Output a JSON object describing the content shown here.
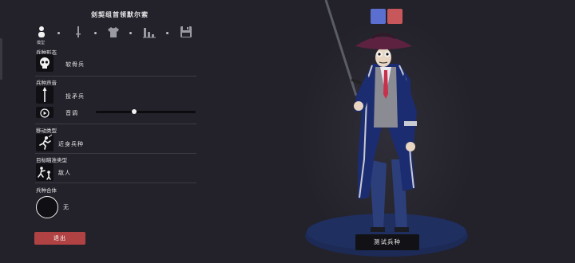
{
  "window": {
    "title": "剑契组首领默尔索"
  },
  "steps": {
    "items": [
      {
        "icon": "person-icon",
        "active": true
      },
      {
        "icon": "sword-icon",
        "active": false
      },
      {
        "icon": "shirt-icon",
        "active": false
      },
      {
        "icon": "stats-icon",
        "active": false
      },
      {
        "icon": "save-icon",
        "active": false
      }
    ],
    "active_label": "模型"
  },
  "sections": {
    "form": {
      "label": "兵种形态",
      "value": "软骨兵"
    },
    "voice": {
      "label": "兵种声音",
      "value": "投矛兵",
      "pitch_label": "音调",
      "pitch_level": 0.38
    },
    "movement": {
      "label": "移动类型",
      "value": "近身兵种"
    },
    "target": {
      "label": "目标瞄准类型",
      "value": "敌人"
    },
    "combine": {
      "label": "兵种合体",
      "value": "无"
    }
  },
  "buttons": {
    "exit": "退出",
    "test": "测试兵种"
  },
  "colors": {
    "team_blue": "#5a6fd0",
    "team_red": "#c8575c",
    "exit_red": "#b04243",
    "background": "#23222a"
  }
}
